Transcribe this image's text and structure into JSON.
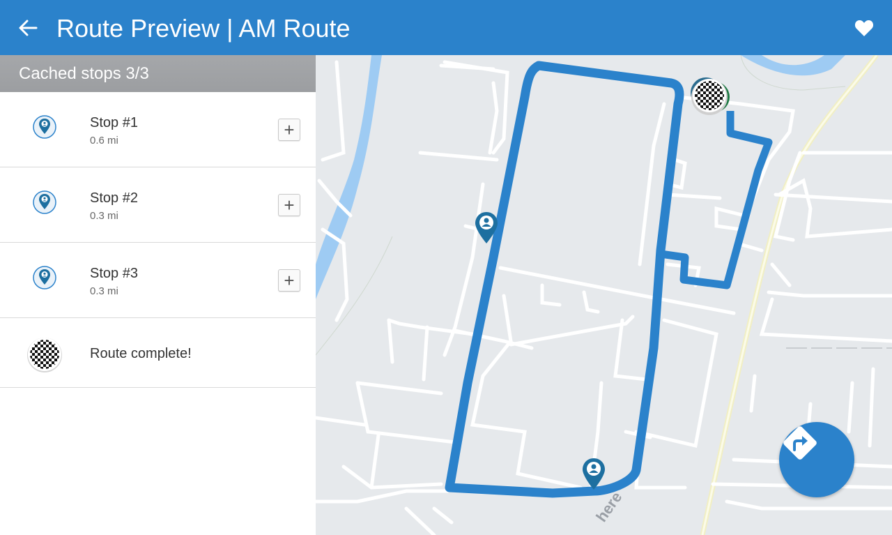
{
  "appbar": {
    "title": "Route Preview | AM Route",
    "back_icon": "arrow-left-icon",
    "favorite_icon": "heart-icon",
    "color": "#2b82cb"
  },
  "panel": {
    "header": "Cached stops 3/3",
    "stops": [
      {
        "name": "Stop #1",
        "distance": "0.6 mi",
        "icon": "stop-pin-icon"
      },
      {
        "name": "Stop #2",
        "distance": "0.3 mi",
        "icon": "stop-pin-icon"
      },
      {
        "name": "Stop #3",
        "distance": "0.3 mi",
        "icon": "stop-pin-icon"
      }
    ],
    "add_label": "+",
    "complete": {
      "label": "Route complete!",
      "icon": "checkered-flag-icon"
    }
  },
  "map": {
    "watermark": "here",
    "route_color": "#2b82cb",
    "navigate_icon": "turn-right-navigation-icon"
  }
}
